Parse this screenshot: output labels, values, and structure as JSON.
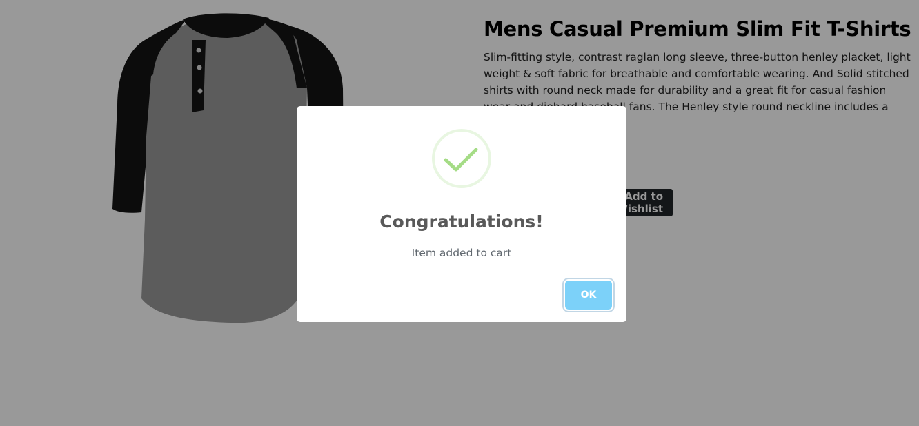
{
  "product": {
    "title": "Mens Casual Premium Slim Fit T-Shirts",
    "description": "Slim-fitting style, contrast raglan long sleeve, three-button henley placket, light weight & soft fabric for breathable and comfortable wearing. And Solid stitched shirts with round neck made for durability and a great fit for casual fashion wear and diehard baseball fans. The Henley style round neckline includes a three-button placket.",
    "wishlist_label": "Add to Wishlist"
  },
  "modal": {
    "title": "Congratulations!",
    "text": "Item added to cart",
    "ok_label": "OK",
    "icon": "success-check-icon"
  },
  "colors": {
    "overlay": "rgba(0,0,0,0.4)",
    "ok_button": "#7cd1f9",
    "check": "#a5dc86",
    "check_ring": "rgba(165,220,134,0.2)",
    "wishlist_button": "#212529"
  }
}
